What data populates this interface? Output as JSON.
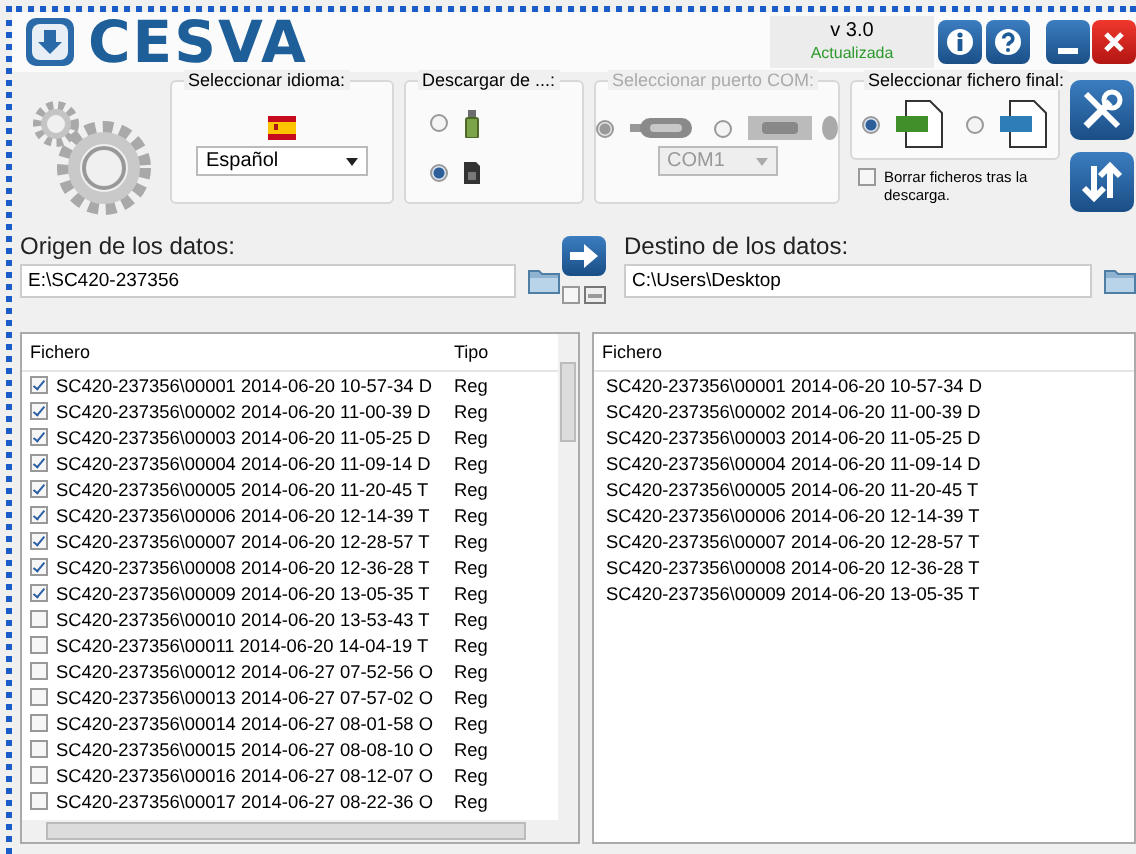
{
  "header": {
    "logo_text": "CESVA",
    "version": "v 3.0",
    "status": "Actualizada"
  },
  "settings": {
    "language": {
      "title": "Seleccionar idioma:",
      "value": "Español"
    },
    "download": {
      "title": "Descargar de ...:",
      "options": [
        {
          "kind": "device",
          "selected": false
        },
        {
          "kind": "card",
          "selected": true
        }
      ]
    },
    "com": {
      "title": "Seleccionar puerto COM:",
      "disabled": true,
      "options": [
        {
          "kind": "usb",
          "selected": true
        },
        {
          "kind": "serial",
          "selected": false
        }
      ],
      "port": "COM1"
    },
    "final_file": {
      "title": "Seleccionar fichero final:",
      "options": [
        {
          "kind": "csv",
          "selected": true
        },
        {
          "kind": "cdf",
          "selected": false
        }
      ]
    },
    "delete_after": {
      "label": "Borrar ficheros tras la descarga.",
      "checked": false
    }
  },
  "origin": {
    "label": "Origen de los datos:",
    "path": "E:\\SC420-237356"
  },
  "transfer_option": {
    "checked": false
  },
  "destination": {
    "label": "Destino de los datos:",
    "path": "C:\\Users\\Desktop"
  },
  "source_list": {
    "columns": [
      "Fichero",
      "Tipo"
    ],
    "rows": [
      {
        "name": "SC420-237356\\00001 2014-06-20 10-57-34 D",
        "type": "Reg",
        "checked": true
      },
      {
        "name": "SC420-237356\\00002 2014-06-20 11-00-39 D",
        "type": "Reg",
        "checked": true
      },
      {
        "name": "SC420-237356\\00003 2014-06-20 11-05-25 D",
        "type": "Reg",
        "checked": true
      },
      {
        "name": "SC420-237356\\00004 2014-06-20 11-09-14 D",
        "type": "Reg",
        "checked": true
      },
      {
        "name": "SC420-237356\\00005 2014-06-20 11-20-45 T",
        "type": "Reg",
        "checked": true
      },
      {
        "name": "SC420-237356\\00006 2014-06-20 12-14-39 T",
        "type": "Reg",
        "checked": true
      },
      {
        "name": "SC420-237356\\00007 2014-06-20 12-28-57 T",
        "type": "Reg",
        "checked": true
      },
      {
        "name": "SC420-237356\\00008 2014-06-20 12-36-28 T",
        "type": "Reg",
        "checked": true
      },
      {
        "name": "SC420-237356\\00009 2014-06-20 13-05-35 T",
        "type": "Reg",
        "checked": true
      },
      {
        "name": "SC420-237356\\00010 2014-06-20 13-53-43 T",
        "type": "Reg",
        "checked": false
      },
      {
        "name": "SC420-237356\\00011 2014-06-20 14-04-19 T",
        "type": "Reg",
        "checked": false
      },
      {
        "name": "SC420-237356\\00012 2014-06-27 07-52-56 O",
        "type": "Reg",
        "checked": false
      },
      {
        "name": "SC420-237356\\00013 2014-06-27 07-57-02 O",
        "type": "Reg",
        "checked": false
      },
      {
        "name": "SC420-237356\\00014 2014-06-27 08-01-58 O",
        "type": "Reg",
        "checked": false
      },
      {
        "name": "SC420-237356\\00015 2014-06-27 08-08-10 O",
        "type": "Reg",
        "checked": false
      },
      {
        "name": "SC420-237356\\00016 2014-06-27 08-12-07 O",
        "type": "Reg",
        "checked": false
      },
      {
        "name": "SC420-237356\\00017 2014-06-27 08-22-36 O",
        "type": "Reg",
        "checked": false
      }
    ]
  },
  "destination_list": {
    "columns": [
      "Fichero"
    ],
    "rows": [
      "SC420-237356\\00001 2014-06-20 10-57-34 D",
      "SC420-237356\\00002 2014-06-20 11-00-39 D",
      "SC420-237356\\00003 2014-06-20 11-05-25 D",
      "SC420-237356\\00004 2014-06-20 11-09-14 D",
      "SC420-237356\\00005 2014-06-20 11-20-45 T",
      "SC420-237356\\00006 2014-06-20 12-14-39 T",
      "SC420-237356\\00007 2014-06-20 12-28-57 T",
      "SC420-237356\\00008 2014-06-20 12-36-28 T",
      "SC420-237356\\00009 2014-06-20 13-05-35 T"
    ]
  }
}
